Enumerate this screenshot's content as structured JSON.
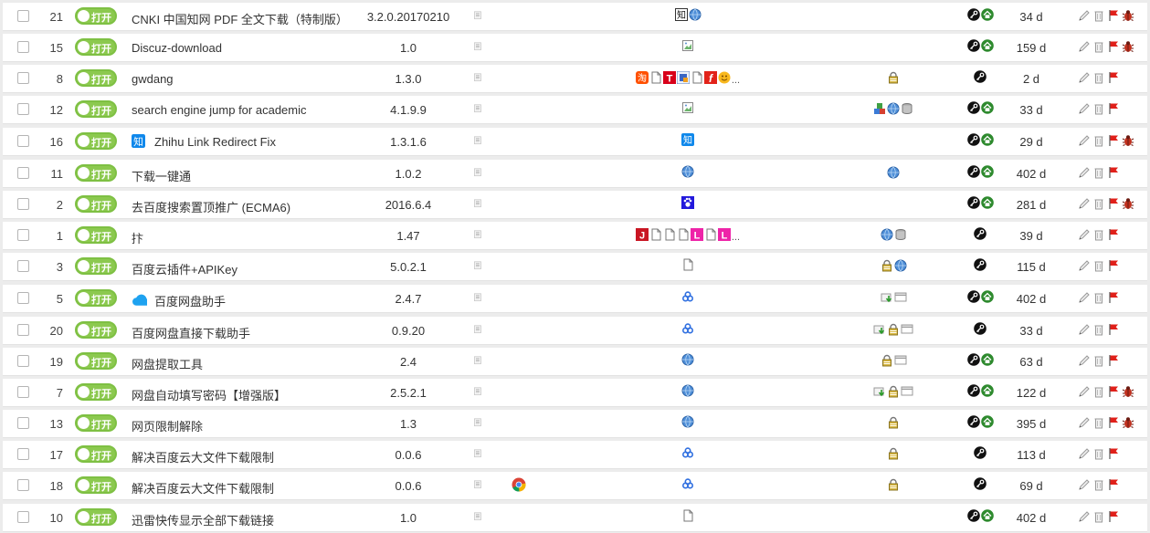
{
  "toggle_label": "打开",
  "colors": {
    "toggle": "#8cc94f",
    "toggle_border": "#7ec043",
    "row_bg": "#ffffff",
    "page_bg": "#ececec"
  },
  "scripts": [
    {
      "index": "21",
      "name": "CNKI 中国知网 PDF 全文下载（特制版）",
      "version": "3.2.0.20170210",
      "name_icon": null,
      "extra": [],
      "sites": [
        "zhi-box",
        "globe"
      ],
      "sites_more": "",
      "features": [],
      "actions": [
        "key",
        "home"
      ],
      "updated": "34 d",
      "tools": [
        "edit",
        "trash",
        "flag",
        "bug"
      ]
    },
    {
      "index": "15",
      "name": "Discuz-download",
      "version": "1.0",
      "name_icon": null,
      "extra": [],
      "sites": [
        "broken-img"
      ],
      "sites_more": "",
      "features": [],
      "actions": [
        "key",
        "home"
      ],
      "updated": "159 d",
      "tools": [
        "edit",
        "trash",
        "flag",
        "bug"
      ]
    },
    {
      "index": "8",
      "name": "gwdang",
      "version": "1.3.0",
      "name_icon": null,
      "extra": [],
      "sites": [
        "taobao",
        "page",
        "tmall",
        "site-blue",
        "page",
        "red-f",
        "smile"
      ],
      "sites_more": "...",
      "features": [
        "lock"
      ],
      "actions": [
        "key"
      ],
      "updated": "2 d",
      "tools": [
        "edit",
        "trash",
        "flag"
      ]
    },
    {
      "index": "12",
      "name": "search engine jump for academic",
      "version": "4.1.9.9",
      "name_icon": null,
      "extra": [],
      "sites": [
        "broken-img"
      ],
      "sites_more": "",
      "features": [
        "blocks",
        "globe",
        "db"
      ],
      "actions": [
        "key",
        "home"
      ],
      "updated": "33 d",
      "tools": [
        "edit",
        "trash",
        "flag"
      ]
    },
    {
      "index": "16",
      "name": "Zhihu Link Redirect Fix",
      "version": "1.3.1.6",
      "name_icon": "zhihu",
      "extra": [],
      "sites": [
        "zhihu"
      ],
      "sites_more": "",
      "features": [],
      "actions": [
        "key",
        "home"
      ],
      "updated": "29 d",
      "tools": [
        "edit",
        "trash",
        "flag",
        "bug"
      ]
    },
    {
      "index": "11",
      "name": "下载一键通",
      "version": "1.0.2",
      "name_icon": null,
      "extra": [],
      "sites": [
        "globe"
      ],
      "sites_more": "",
      "features": [
        "globe"
      ],
      "actions": [
        "key",
        "home"
      ],
      "updated": "402 d",
      "tools": [
        "edit",
        "trash",
        "flag"
      ]
    },
    {
      "index": "2",
      "name": "去百度搜索置顶推广 (ECMA6)",
      "version": "2016.6.4",
      "name_icon": null,
      "extra": [],
      "sites": [
        "baidu"
      ],
      "sites_more": "",
      "features": [],
      "actions": [
        "key",
        "home"
      ],
      "updated": "281 d",
      "tools": [
        "edit",
        "trash",
        "flag",
        "bug"
      ]
    },
    {
      "index": "1",
      "name": "抃",
      "version": "1.47",
      "name_icon": null,
      "extra": [],
      "sites": [
        "jd",
        "page",
        "page",
        "page",
        "pink",
        "page",
        "pink"
      ],
      "sites_more": "...",
      "features": [
        "globe",
        "db"
      ],
      "actions": [
        "key"
      ],
      "updated": "39 d",
      "tools": [
        "edit",
        "trash",
        "flag"
      ]
    },
    {
      "index": "3",
      "name": "百度云插件+APIKey",
      "version": "5.0.2.1",
      "name_icon": null,
      "extra": [],
      "sites": [
        "page"
      ],
      "sites_more": "",
      "features": [
        "lock",
        "globe"
      ],
      "actions": [
        "key"
      ],
      "updated": "115 d",
      "tools": [
        "edit",
        "trash",
        "flag"
      ]
    },
    {
      "index": "5",
      "name": "百度网盘助手",
      "version": "2.4.7",
      "name_icon": "cloud",
      "extra": [],
      "sites": [
        "baiduyun"
      ],
      "sites_more": "",
      "features": [
        "download",
        "window"
      ],
      "actions": [
        "key",
        "home"
      ],
      "updated": "402 d",
      "tools": [
        "edit",
        "trash",
        "flag"
      ]
    },
    {
      "index": "20",
      "name": "百度网盘直接下载助手",
      "version": "0.9.20",
      "name_icon": null,
      "extra": [],
      "sites": [
        "baiduyun"
      ],
      "sites_more": "",
      "features": [
        "download",
        "lock",
        "window"
      ],
      "actions": [
        "key"
      ],
      "updated": "33 d",
      "tools": [
        "edit",
        "trash",
        "flag"
      ]
    },
    {
      "index": "19",
      "name": "网盘提取工具",
      "version": "2.4",
      "name_icon": null,
      "extra": [],
      "sites": [
        "globe"
      ],
      "sites_more": "",
      "features": [
        "lock",
        "window"
      ],
      "actions": [
        "key",
        "home"
      ],
      "updated": "63 d",
      "tools": [
        "edit",
        "trash",
        "flag"
      ]
    },
    {
      "index": "7",
      "name": "网盘自动填写密码【增强版】",
      "version": "2.5.2.1",
      "name_icon": null,
      "extra": [],
      "sites": [
        "globe"
      ],
      "sites_more": "",
      "features": [
        "download",
        "lock",
        "window"
      ],
      "actions": [
        "key",
        "home"
      ],
      "updated": "122 d",
      "tools": [
        "edit",
        "trash",
        "flag",
        "bug"
      ]
    },
    {
      "index": "13",
      "name": "网页限制解除",
      "version": "1.3",
      "name_icon": null,
      "extra": [],
      "sites": [
        "globe"
      ],
      "sites_more": "",
      "features": [
        "lock"
      ],
      "actions": [
        "key",
        "home"
      ],
      "updated": "395 d",
      "tools": [
        "edit",
        "trash",
        "flag",
        "bug"
      ]
    },
    {
      "index": "17",
      "name": "解决百度云大文件下载限制",
      "version": "0.0.6",
      "name_icon": null,
      "extra": [],
      "sites": [
        "baiduyun"
      ],
      "sites_more": "",
      "features": [
        "lock"
      ],
      "actions": [
        "key"
      ],
      "updated": "113 d",
      "tools": [
        "edit",
        "trash",
        "flag"
      ]
    },
    {
      "index": "18",
      "name": "解决百度云大文件下载限制",
      "version": "0.0.6",
      "name_icon": null,
      "extra": [
        "chrome"
      ],
      "sites": [
        "baiduyun"
      ],
      "sites_more": "",
      "features": [
        "lock"
      ],
      "actions": [
        "key"
      ],
      "updated": "69 d",
      "tools": [
        "edit",
        "trash",
        "flag"
      ]
    },
    {
      "index": "10",
      "name": "迅雷快传显示全部下载链接",
      "version": "1.0",
      "name_icon": null,
      "extra": [],
      "sites": [
        "page"
      ],
      "sites_more": "",
      "features": [],
      "actions": [
        "key",
        "home"
      ],
      "updated": "402 d",
      "tools": [
        "edit",
        "trash",
        "flag"
      ]
    }
  ]
}
